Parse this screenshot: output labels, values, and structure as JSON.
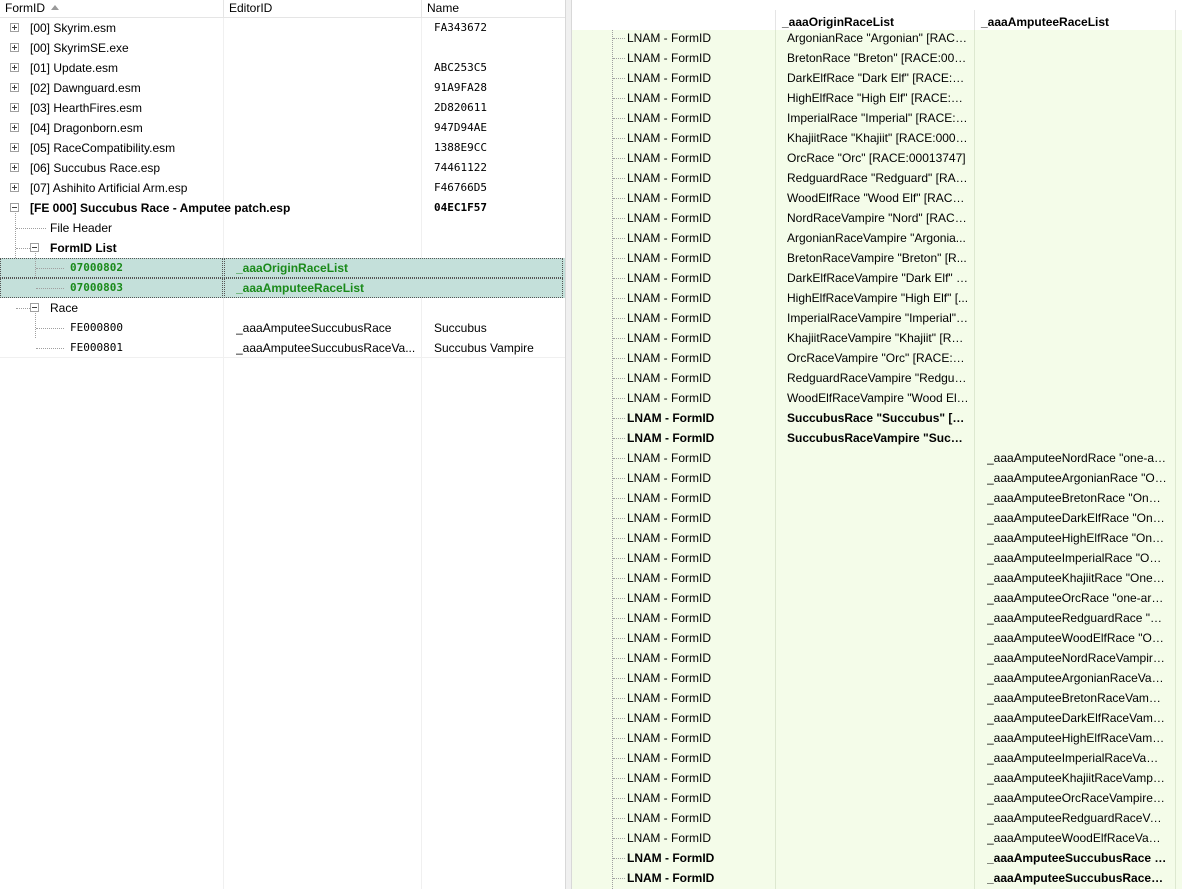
{
  "left": {
    "headers": {
      "formid": "FormID",
      "editorid": "EditorID",
      "name": "Name"
    },
    "plugins": [
      {
        "label": "[00] Skyrim.esm",
        "name": "FA343672"
      },
      {
        "label": "[00] SkyrimSE.exe",
        "name": ""
      },
      {
        "label": "[01] Update.esm",
        "name": "ABC253C5"
      },
      {
        "label": "[02] Dawnguard.esm",
        "name": "91A9FA28"
      },
      {
        "label": "[03] HearthFires.esm",
        "name": "2D820611"
      },
      {
        "label": "[04] Dragonborn.esm",
        "name": "947D94AE"
      },
      {
        "label": "[05] RaceCompatibility.esm",
        "name": "1388E9CC"
      },
      {
        "label": "[06] Succubus Race.esp",
        "name": "74461122"
      },
      {
        "label": "[07] Ashihito Artificial Arm.esp",
        "name": "F46766D5"
      }
    ],
    "active_plugin": {
      "label": "[FE 000] Succubus Race - Amputee patch.esp",
      "name": "04EC1F57"
    },
    "file_header": "File Header",
    "formid_list": {
      "label": "FormID List",
      "items": [
        {
          "formid": "07000802",
          "editorid": "_aaaOriginRaceList"
        },
        {
          "formid": "07000803",
          "editorid": "_aaaAmputeeRaceList"
        }
      ]
    },
    "race": {
      "label": "Race",
      "items": [
        {
          "formid": "FE000800",
          "editorid": "_aaaAmputeeSuccubusRace",
          "name": "Succubus"
        },
        {
          "formid": "FE000801",
          "editorid": "_aaaAmputeeSuccubusRaceVa...",
          "name": "Succubus Vampire"
        }
      ]
    }
  },
  "right": {
    "headers": {
      "col1": "_aaaOriginRaceList",
      "col2": "_aaaAmputeeRaceList"
    },
    "rows": [
      {
        "label": "LNAM - FormID",
        "v1": "ArgonianRace \"Argonian\" [RACE:...",
        "v2": "",
        "bold": false
      },
      {
        "label": "LNAM - FormID",
        "v1": "BretonRace \"Breton\" [RACE:0001...",
        "v2": "",
        "bold": false
      },
      {
        "label": "LNAM - FormID",
        "v1": "DarkElfRace \"Dark Elf\" [RACE:000...",
        "v2": "",
        "bold": false
      },
      {
        "label": "LNAM - FormID",
        "v1": "HighElfRace \"High Elf\" [RACE:00...",
        "v2": "",
        "bold": false
      },
      {
        "label": "LNAM - FormID",
        "v1": "ImperialRace \"Imperial\" [RACE:0...",
        "v2": "",
        "bold": false
      },
      {
        "label": "LNAM - FormID",
        "v1": "KhajiitRace \"Khajiit\" [RACE:00013...",
        "v2": "",
        "bold": false
      },
      {
        "label": "LNAM - FormID",
        "v1": "OrcRace \"Orc\" [RACE:00013747]",
        "v2": "",
        "bold": false
      },
      {
        "label": "LNAM - FormID",
        "v1": "RedguardRace \"Redguard\" [RAC...",
        "v2": "",
        "bold": false
      },
      {
        "label": "LNAM - FormID",
        "v1": "WoodElfRace \"Wood Elf\" [RACE:...",
        "v2": "",
        "bold": false
      },
      {
        "label": "LNAM - FormID",
        "v1": "NordRaceVampire \"Nord\" [RACE...",
        "v2": "",
        "bold": false
      },
      {
        "label": "LNAM - FormID",
        "v1": "ArgonianRaceVampire \"Argonia...",
        "v2": "",
        "bold": false
      },
      {
        "label": "LNAM - FormID",
        "v1": "BretonRaceVampire \"Breton\" [R...",
        "v2": "",
        "bold": false
      },
      {
        "label": "LNAM - FormID",
        "v1": "DarkElfRaceVampire \"Dark Elf\" [R...",
        "v2": "",
        "bold": false
      },
      {
        "label": "LNAM - FormID",
        "v1": "HighElfRaceVampire \"High Elf\" [...",
        "v2": "",
        "bold": false
      },
      {
        "label": "LNAM - FormID",
        "v1": "ImperialRaceVampire \"Imperial\" ...",
        "v2": "",
        "bold": false
      },
      {
        "label": "LNAM - FormID",
        "v1": "KhajiitRaceVampire \"Khajiit\" [RA...",
        "v2": "",
        "bold": false
      },
      {
        "label": "LNAM - FormID",
        "v1": "OrcRaceVampire \"Orc\" [RACE:00...",
        "v2": "",
        "bold": false
      },
      {
        "label": "LNAM - FormID",
        "v1": "RedguardRaceVampire \"Redguar...",
        "v2": "",
        "bold": false
      },
      {
        "label": "LNAM - FormID",
        "v1": "WoodElfRaceVampire \"Wood Elf...",
        "v2": "",
        "bold": false
      },
      {
        "label": "LNAM - FormID",
        "v1": "SuccubusRace \"Succubus\" [RA...",
        "v2": "",
        "bold": true
      },
      {
        "label": "LNAM - FormID",
        "v1": "SuccubusRaceVampire \"Succu...",
        "v2": "",
        "bold": true
      },
      {
        "label": "LNAM - FormID",
        "v1": "",
        "v2": "_aaaAmputeeNordRace \"one-ar...",
        "bold": false
      },
      {
        "label": "LNAM - FormID",
        "v1": "",
        "v2": "_aaaAmputeeArgonianRace \"On...",
        "bold": false
      },
      {
        "label": "LNAM - FormID",
        "v1": "",
        "v2": "_aaaAmputeeBretonRace \"One-a...",
        "bold": false
      },
      {
        "label": "LNAM - FormID",
        "v1": "",
        "v2": "_aaaAmputeeDarkElfRace \"One-...",
        "bold": false
      },
      {
        "label": "LNAM - FormID",
        "v1": "",
        "v2": "_aaaAmputeeHighElfRace \"One-...",
        "bold": false
      },
      {
        "label": "LNAM - FormID",
        "v1": "",
        "v2": "_aaaAmputeeImperialRace \"One...",
        "bold": false
      },
      {
        "label": "LNAM - FormID",
        "v1": "",
        "v2": "_aaaAmputeeKhajiitRace \"One-a...",
        "bold": false
      },
      {
        "label": "LNAM - FormID",
        "v1": "",
        "v2": "_aaaAmputeeOrcRace \"one-arm...",
        "bold": false
      },
      {
        "label": "LNAM - FormID",
        "v1": "",
        "v2": "_aaaAmputeeRedguardRace \"On...",
        "bold": false
      },
      {
        "label": "LNAM - FormID",
        "v1": "",
        "v2": "_aaaAmputeeWoodElfRace \"One...",
        "bold": false
      },
      {
        "label": "LNAM - FormID",
        "v1": "",
        "v2": "_aaaAmputeeNordRaceVampire ...",
        "bold": false
      },
      {
        "label": "LNAM - FormID",
        "v1": "",
        "v2": "_aaaAmputeeArgonianRaceVam...",
        "bold": false
      },
      {
        "label": "LNAM - FormID",
        "v1": "",
        "v2": "_aaaAmputeeBretonRaceVampir...",
        "bold": false
      },
      {
        "label": "LNAM - FormID",
        "v1": "",
        "v2": "_aaaAmputeeDarkElfRaceVampir...",
        "bold": false
      },
      {
        "label": "LNAM - FormID",
        "v1": "",
        "v2": "_aaaAmputeeHighElfRaceVampi...",
        "bold": false
      },
      {
        "label": "LNAM - FormID",
        "v1": "",
        "v2": "_aaaAmputeeImperialRaceVamp...",
        "bold": false
      },
      {
        "label": "LNAM - FormID",
        "v1": "",
        "v2": "_aaaAmputeeKhajiitRaceVampir...",
        "bold": false
      },
      {
        "label": "LNAM - FormID",
        "v1": "",
        "v2": "_aaaAmputeeOrcRaceVampire \"...",
        "bold": false
      },
      {
        "label": "LNAM - FormID",
        "v1": "",
        "v2": "_aaaAmputeeRedguardRaceVam...",
        "bold": false
      },
      {
        "label": "LNAM - FormID",
        "v1": "",
        "v2": "_aaaAmputeeWoodElfRaceVamp...",
        "bold": false
      },
      {
        "label": "LNAM - FormID",
        "v1": "",
        "v2": "_aaaAmputeeSuccubusRace \"S...",
        "bold": true
      },
      {
        "label": "LNAM - FormID",
        "v1": "",
        "v2": "_aaaAmputeeSuccubusRaceVa...",
        "bold": true
      }
    ]
  },
  "colors": {
    "selection": "#c4e0da",
    "green_text": "#1a8a1a",
    "record_bg": "#f4fce9"
  }
}
